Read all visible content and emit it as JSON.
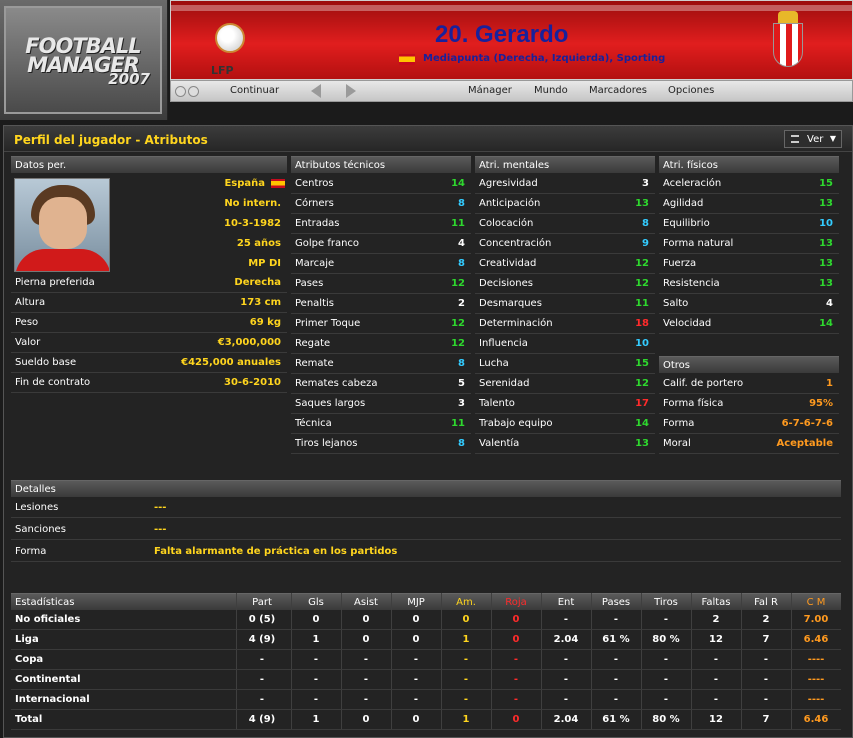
{
  "logo": {
    "line1": "FOOTBALL",
    "line2": "MANAGER",
    "line3": "2007"
  },
  "header": {
    "player_title": "20. Gerardo",
    "player_subtitle": "Mediapunta (Derecha, Izquierda), Sporting",
    "league_logo_text": "LFP",
    "colors": {
      "banner_red": "#e11e1e",
      "title_blue": "#18219c"
    }
  },
  "nav": {
    "continue": "Continuar",
    "manager": "Mánager",
    "world": "Mundo",
    "scores": "Marcadores",
    "options": "Opciones"
  },
  "panel": {
    "title": "Perfil del jugador - Atributos",
    "view_label": "Ver"
  },
  "personal": {
    "head": "Datos per.",
    "nationality": "España",
    "international": "No intern.",
    "dob": "10-3-1982",
    "age": "25 años",
    "position": "MP DI",
    "rows": [
      {
        "k": "Pierna preferida",
        "v": "Derecha"
      },
      {
        "k": "Altura",
        "v": "173 cm"
      },
      {
        "k": "Peso",
        "v": "69 kg"
      },
      {
        "k": "Valor",
        "v": "€3,000,000"
      },
      {
        "k": "Sueldo base",
        "v": "€425,000 anuales"
      },
      {
        "k": "Fin de contrato",
        "v": "30-6-2010"
      }
    ]
  },
  "technical": {
    "head": "Atributos técnicos",
    "rows": [
      {
        "k": "Centros",
        "v": "14"
      },
      {
        "k": "Córners",
        "v": "8"
      },
      {
        "k": "Entradas",
        "v": "11"
      },
      {
        "k": "Golpe franco",
        "v": "4"
      },
      {
        "k": "Marcaje",
        "v": "8"
      },
      {
        "k": "Pases",
        "v": "12"
      },
      {
        "k": "Penaltis",
        "v": "2"
      },
      {
        "k": "Primer Toque",
        "v": "12"
      },
      {
        "k": "Regate",
        "v": "12"
      },
      {
        "k": "Remate",
        "v": "8"
      },
      {
        "k": "Remates cabeza",
        "v": "5"
      },
      {
        "k": "Saques largos",
        "v": "3"
      },
      {
        "k": "Técnica",
        "v": "11"
      },
      {
        "k": "Tiros lejanos",
        "v": "8"
      }
    ]
  },
  "mental": {
    "head": "Atri. mentales",
    "rows": [
      {
        "k": "Agresividad",
        "v": "3"
      },
      {
        "k": "Anticipación",
        "v": "13"
      },
      {
        "k": "Colocación",
        "v": "8"
      },
      {
        "k": "Concentración",
        "v": "9"
      },
      {
        "k": "Creatividad",
        "v": "12"
      },
      {
        "k": "Decisiones",
        "v": "12"
      },
      {
        "k": "Desmarques",
        "v": "11"
      },
      {
        "k": "Determinación",
        "v": "18"
      },
      {
        "k": "Influencia",
        "v": "10"
      },
      {
        "k": "Lucha",
        "v": "15"
      },
      {
        "k": "Serenidad",
        "v": "12"
      },
      {
        "k": "Talento",
        "v": "17"
      },
      {
        "k": "Trabajo equipo",
        "v": "14"
      },
      {
        "k": "Valentía",
        "v": "13"
      }
    ]
  },
  "physical": {
    "head": "Atri. físicos",
    "rows": [
      {
        "k": "Aceleración",
        "v": "15"
      },
      {
        "k": "Agilidad",
        "v": "13"
      },
      {
        "k": "Equilibrio",
        "v": "10"
      },
      {
        "k": "Forma natural",
        "v": "13"
      },
      {
        "k": "Fuerza",
        "v": "13"
      },
      {
        "k": "Resistencia",
        "v": "13"
      },
      {
        "k": "Salto",
        "v": "4"
      },
      {
        "k": "Velocidad",
        "v": "14"
      }
    ]
  },
  "others": {
    "head": "Otros",
    "rows": [
      {
        "k": "Calif. de portero",
        "v": "1"
      },
      {
        "k": "Forma física",
        "v": "95%"
      },
      {
        "k": "Forma",
        "v": "6-7-6-7-6"
      },
      {
        "k": "Moral",
        "v": "Aceptable"
      }
    ]
  },
  "details": {
    "head": "Detalles",
    "rows": [
      {
        "k": "Lesiones",
        "v": "---"
      },
      {
        "k": "Sanciones",
        "v": "---"
      },
      {
        "k": "Forma",
        "v": "Falta alarmante de práctica en los partidos"
      }
    ]
  },
  "stats": {
    "head": "Estadísticas",
    "columns": [
      "Part",
      "Gls",
      "Asist",
      "MJP",
      "Am.",
      "Roja",
      "Ent",
      "Pases",
      "Tiros",
      "Faltas",
      "Fal R",
      "C M"
    ],
    "rows": [
      {
        "name": "No oficiales",
        "vals": [
          "0 (5)",
          "0",
          "0",
          "0",
          "0",
          "0",
          "-",
          "-",
          "-",
          "2",
          "2",
          "7.00"
        ]
      },
      {
        "name": "Liga",
        "vals": [
          "4 (9)",
          "1",
          "0",
          "0",
          "1",
          "0",
          "2.04",
          "61 %",
          "80 %",
          "12",
          "7",
          "6.46"
        ]
      },
      {
        "name": "Copa",
        "vals": [
          "-",
          "-",
          "-",
          "-",
          "-",
          "-",
          "-",
          "-",
          "-",
          "-",
          "-",
          "----"
        ]
      },
      {
        "name": "Continental",
        "vals": [
          "-",
          "-",
          "-",
          "-",
          "-",
          "-",
          "-",
          "-",
          "-",
          "-",
          "-",
          "----"
        ]
      },
      {
        "name": "Internacional",
        "vals": [
          "-",
          "-",
          "-",
          "-",
          "-",
          "-",
          "-",
          "-",
          "-",
          "-",
          "-",
          "----"
        ]
      },
      {
        "name": "Total",
        "vals": [
          "4 (9)",
          "1",
          "0",
          "0",
          "1",
          "0",
          "2.04",
          "61 %",
          "80 %",
          "12",
          "7",
          "6.46"
        ]
      }
    ]
  },
  "colors": {
    "accent_yellow": "#ffd51e",
    "attr_green": "#2ed82e",
    "attr_cyan": "#33ccff",
    "attr_red": "#ff2b2b",
    "attr_orange": "#ff9a1f"
  }
}
